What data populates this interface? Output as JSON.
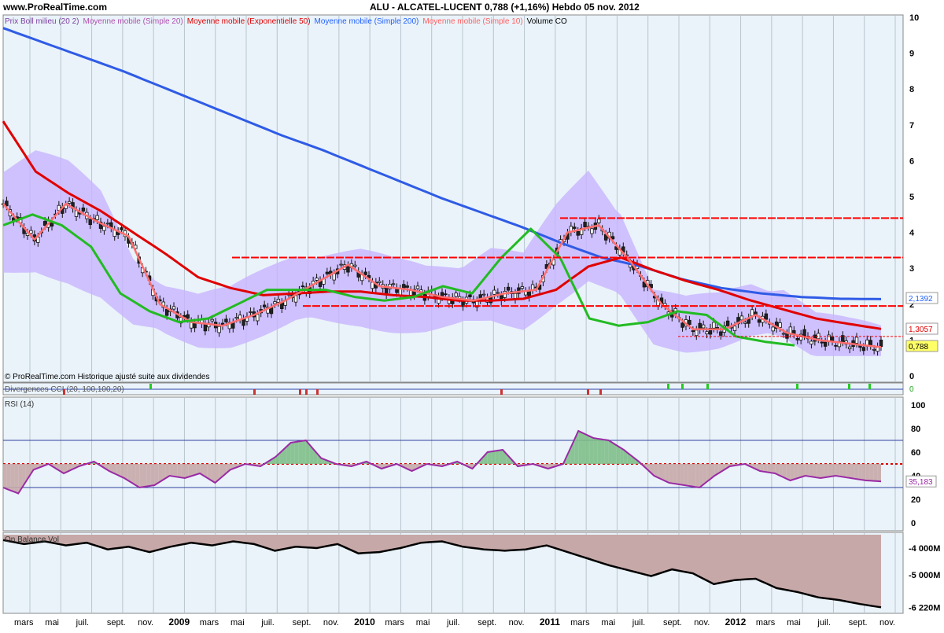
{
  "header": {
    "site": "www.ProRealTime.com",
    "title": "ALU - ALCATEL-LUCENT    0,788 (+1,16%)   Hebdo  05 nov. 2012"
  },
  "price_panel": {
    "legend": [
      {
        "text": "Prix Boll milieu (20 2)",
        "color": "#7b3fa0"
      },
      {
        "text": "Moyenne mobile (Simple 20)",
        "color": "#b04fb0"
      },
      {
        "text": "Moyenne mobile (Exponentielle 50)",
        "color": "#e00000"
      },
      {
        "text": "Moyenne mobile (Simple 200)",
        "color": "#2060ff"
      },
      {
        "text": "Moyenne mobile (Simple 10)",
        "color": "#ff6060"
      },
      {
        "text": "Volume CO",
        "color": "#000000"
      }
    ],
    "footnote": "© ProRealTime.com Historique ajusté suite aux dividendes",
    "y_ticks": [
      "10",
      "9",
      "8",
      "7",
      "6",
      "5",
      "4",
      "3",
      "2",
      "1",
      "0"
    ],
    "last_tags": [
      {
        "text": "2,1392",
        "color": "#2060ff"
      },
      {
        "text": "1,3057",
        "color": "#e00000"
      },
      {
        "text": "0,788",
        "color": "#000000"
      }
    ]
  },
  "cci_panel": {
    "label": "Divergences CCI (20, 100,100,20)",
    "value": "0"
  },
  "rsi_panel": {
    "label": "RSI (14)",
    "y_ticks": [
      "100",
      "80",
      "60",
      "40",
      "20",
      "0"
    ],
    "last_value": "35,183"
  },
  "obv_panel": {
    "label": "On Balance Vol",
    "y_ticks": [
      "-4 000M",
      "-5 000M",
      "-6 220M"
    ]
  },
  "x_axis": {
    "labels": [
      "mars",
      "mai",
      "juil.",
      "sept.",
      "nov.",
      "2009",
      "mars",
      "mai",
      "juil.",
      "sept.",
      "nov.",
      "2010",
      "mars",
      "mai",
      "juil.",
      "sept.",
      "nov.",
      "2011",
      "mars",
      "mai",
      "juil.",
      "sept.",
      "nov.",
      "2012",
      "mars",
      "mai",
      "juil.",
      "sept.",
      "nov."
    ]
  },
  "colors": {
    "sma200": "#2f5be6",
    "ema50": "#e00000",
    "sma10": "#ff6e6e",
    "boll_mid": "#22bb22",
    "boll_band": "#c8b4ff",
    "panel_bg": "#eaf3fa",
    "rsi_line": "#9a2aa5",
    "obv_fill": "#c7a8a8",
    "resistance": "#ff0000"
  },
  "chart_data": [
    {
      "type": "line",
      "title": "ALU - ALCATEL-LUCENT",
      "ylim": [
        0,
        10
      ],
      "series": [
        {
          "name": "Moyenne mobile (Simple 200)",
          "values": [
            9.7,
            9.3,
            8.9,
            8.5,
            8.05,
            7.6,
            7.15,
            6.7,
            6.3,
            5.85,
            5.4,
            4.95,
            4.55,
            4.15,
            3.7,
            3.3,
            3.05,
            2.7,
            2.45,
            2.3,
            2.2,
            2.15,
            2.14
          ]
        },
        {
          "name": "Moyenne mobile (Exponentielle 50)",
          "values": [
            7.1,
            5.7,
            5.1,
            4.6,
            4.0,
            3.4,
            2.75,
            2.45,
            2.25,
            2.3,
            2.35,
            2.35,
            2.25,
            2.2,
            2.1,
            2.1,
            2.15,
            2.4,
            3.05,
            3.3,
            2.95,
            2.65,
            2.4,
            2.1,
            1.85,
            1.6,
            1.45,
            1.31
          ]
        },
        {
          "name": "Moyenne mobile (Simple 10)",
          "values": [
            4.8,
            3.8,
            4.8,
            4.3,
            3.9,
            2.0,
            1.5,
            1.4,
            1.7,
            2.1,
            2.6,
            3.1,
            2.5,
            2.4,
            2.2,
            2.1,
            2.3,
            2.4,
            4.0,
            4.2,
            3.2,
            2.0,
            1.3,
            1.3,
            1.7,
            1.2,
            1.0,
            0.9,
            0.8
          ]
        },
        {
          "name": "Prix Boll milieu (20 2)",
          "values": [
            4.2,
            4.5,
            4.2,
            3.6,
            2.3,
            1.8,
            1.5,
            1.6,
            2.0,
            2.4,
            2.4,
            2.4,
            2.2,
            2.1,
            2.2,
            2.5,
            2.3,
            3.3,
            4.1,
            3.3,
            1.6,
            1.4,
            1.5,
            1.8,
            1.7,
            1.1,
            0.95,
            0.85
          ]
        }
      ],
      "resistance_levels": [
        4.4,
        3.3,
        1.95,
        1.1
      ],
      "last": {
        "close": 0.788,
        "change_pct": 1.16
      }
    },
    {
      "type": "line",
      "title": "RSI (14)",
      "ylim": [
        0,
        100
      ],
      "levels": [
        70,
        50,
        30
      ],
      "series": [
        {
          "name": "RSI (14)",
          "values": [
            30,
            25,
            45,
            50,
            42,
            48,
            52,
            44,
            38,
            30,
            32,
            40,
            38,
            42,
            34,
            45,
            50,
            48,
            56,
            68,
            70,
            55,
            50,
            48,
            52,
            46,
            50,
            44,
            50,
            48,
            52,
            46,
            60,
            62,
            48,
            50,
            46,
            50,
            78,
            72,
            70,
            62,
            52,
            40,
            34,
            32,
            30,
            40,
            48,
            50,
            44,
            42,
            36,
            40,
            38,
            40,
            38,
            36,
            35.183
          ]
        }
      ],
      "last": 35.183
    },
    {
      "type": "area",
      "title": "On Balance Vol",
      "series": [
        {
          "name": "On Balance Vol",
          "values": [
            -3700,
            -3850,
            -3750,
            -3900,
            -3800,
            -4050,
            -3950,
            -4150,
            -3950,
            -3800,
            -3900,
            -3750,
            -3850,
            -4100,
            -3950,
            -4000,
            -3850,
            -4200,
            -4150,
            -4000,
            -3800,
            -3750,
            -3950,
            -4050,
            -4100,
            -4050,
            -3900,
            -4150,
            -4400,
            -4650,
            -4850,
            -5050,
            -4800,
            -4950,
            -5350,
            -5200,
            -5150,
            -5500,
            -5650,
            -5850,
            -5950,
            -6100,
            -6220
          ]
        }
      ],
      "last": -6220
    }
  ]
}
